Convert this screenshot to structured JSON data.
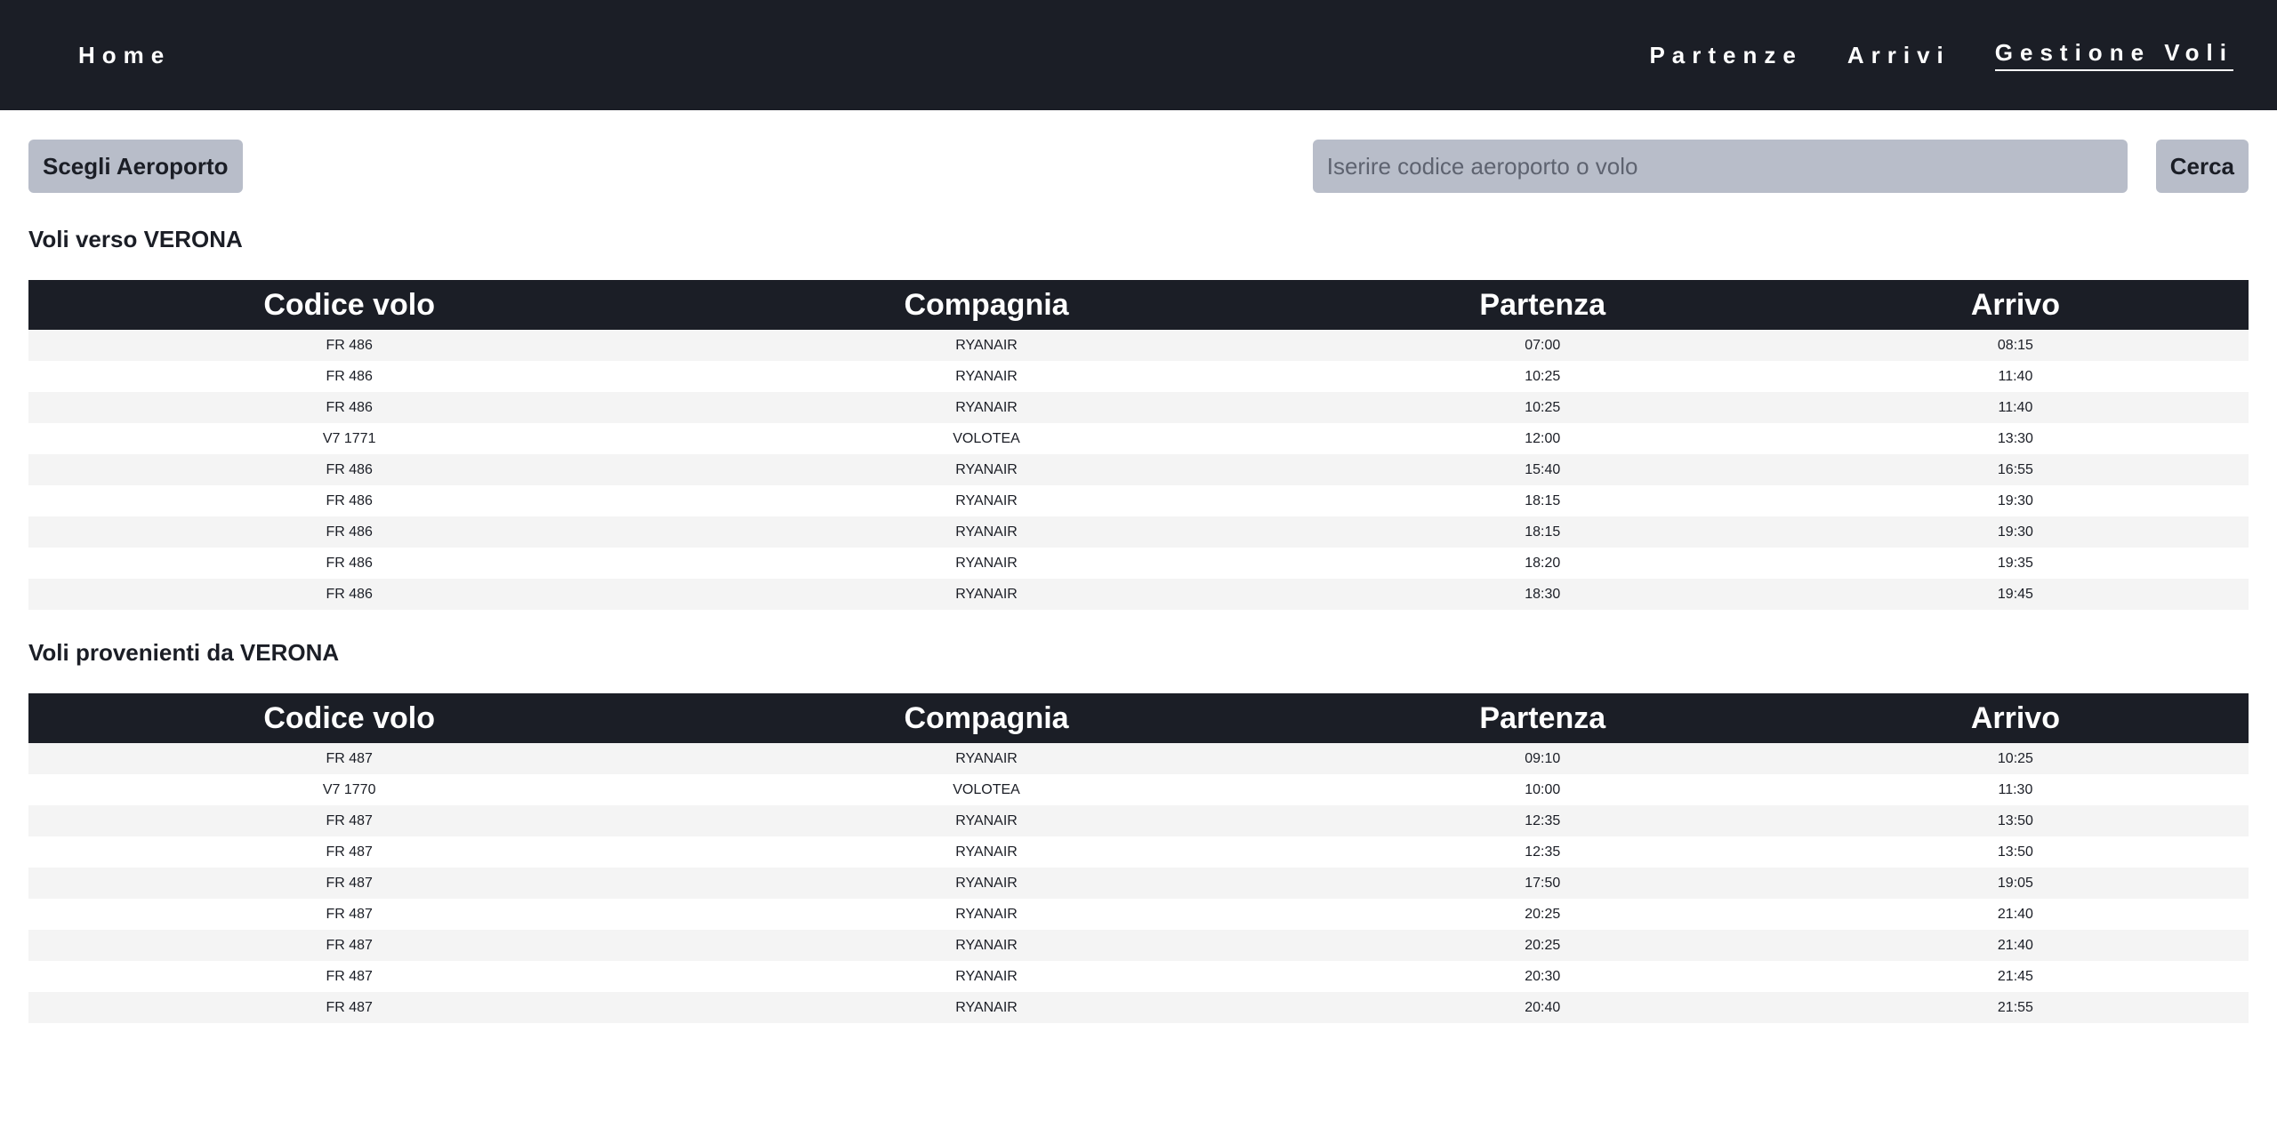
{
  "nav": {
    "home": "Home",
    "partenze": "Partenze",
    "arrivi": "Arrivi",
    "gestione_voli": "Gestione Voli"
  },
  "toolbar": {
    "choose_airport": "Scegli Aeroporto",
    "search_placeholder": "Iserire codice aeroporto o volo",
    "search_value": "",
    "search_button": "Cerca"
  },
  "table_headers": [
    "Codice volo",
    "Compagnia",
    "Partenza",
    "Arrivo"
  ],
  "arrivals_section": {
    "title": "Voli verso VERONA",
    "rows": [
      [
        "FR 486",
        "RYANAIR",
        "07:00",
        "08:15"
      ],
      [
        "FR 486",
        "RYANAIR",
        "10:25",
        "11:40"
      ],
      [
        "FR 486",
        "RYANAIR",
        "10:25",
        "11:40"
      ],
      [
        "V7 1771",
        "VOLOTEA",
        "12:00",
        "13:30"
      ],
      [
        "FR 486",
        "RYANAIR",
        "15:40",
        "16:55"
      ],
      [
        "FR 486",
        "RYANAIR",
        "18:15",
        "19:30"
      ],
      [
        "FR 486",
        "RYANAIR",
        "18:15",
        "19:30"
      ],
      [
        "FR 486",
        "RYANAIR",
        "18:20",
        "19:35"
      ],
      [
        "FR 486",
        "RYANAIR",
        "18:30",
        "19:45"
      ]
    ]
  },
  "departures_section": {
    "title": "Voli provenienti da VERONA",
    "rows": [
      [
        "FR 487",
        "RYANAIR",
        "09:10",
        "10:25"
      ],
      [
        "V7 1770",
        "VOLOTEA",
        "10:00",
        "11:30"
      ],
      [
        "FR 487",
        "RYANAIR",
        "12:35",
        "13:50"
      ],
      [
        "FR 487",
        "RYANAIR",
        "12:35",
        "13:50"
      ],
      [
        "FR 487",
        "RYANAIR",
        "17:50",
        "19:05"
      ],
      [
        "FR 487",
        "RYANAIR",
        "20:25",
        "21:40"
      ],
      [
        "FR 487",
        "RYANAIR",
        "20:25",
        "21:40"
      ],
      [
        "FR 487",
        "RYANAIR",
        "20:30",
        "21:45"
      ],
      [
        "FR 487",
        "RYANAIR",
        "20:40",
        "21:55"
      ]
    ]
  },
  "colors": {
    "navbar_bg": "#1b1e26",
    "button_bg": "#b8bdc9",
    "row_stripe": "#f4f4f4"
  }
}
